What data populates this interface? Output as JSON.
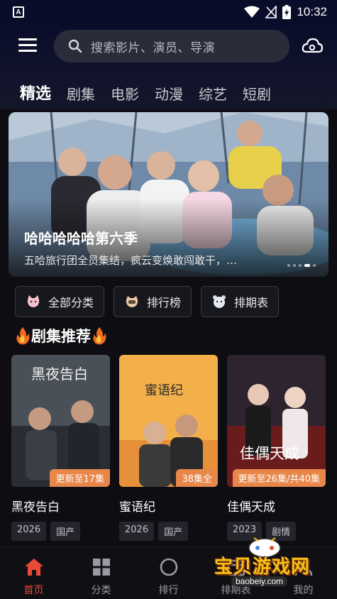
{
  "status_bar": {
    "app_glyph": "A",
    "time": "10:32"
  },
  "search": {
    "placeholder": "搜索影片、演员、导演"
  },
  "tabs": [
    {
      "label": "精选",
      "active": true
    },
    {
      "label": "剧集"
    },
    {
      "label": "电影"
    },
    {
      "label": "动漫"
    },
    {
      "label": "综艺"
    },
    {
      "label": "短剧"
    }
  ],
  "banner": {
    "title": "哈哈哈哈哈第六季",
    "description": "五哈旅行团全员集结，疯云变焕敢闯敢干，…",
    "dots": 5,
    "active_dot": 3
  },
  "quick_links": [
    {
      "label": "全部分类",
      "icon": "cat-icon"
    },
    {
      "label": "排行榜",
      "icon": "cat-face-icon"
    },
    {
      "label": "排期表",
      "icon": "bear-icon"
    }
  ],
  "section": {
    "title": "剧集推荐",
    "icon": "fire-icon"
  },
  "cards": [
    {
      "title": "黑夜告白",
      "badge": "更新至17集",
      "year": "2026",
      "tag": "国产",
      "poster_text": "黑夜告白",
      "colors": [
        "#5a6270",
        "#2a2e36"
      ]
    },
    {
      "title": "蜜语纪",
      "badge": "38集全",
      "year": "2026",
      "tag": "国产",
      "poster_text": "蜜语纪",
      "colors": [
        "#f4b24a",
        "#e07a2a"
      ]
    },
    {
      "title": "佳偶天成",
      "badge": "更新至26集/共40集",
      "year": "2023",
      "tag": "剧情",
      "poster_text": "佳偶天成",
      "colors": [
        "#3a2a3a",
        "#7a1a1a"
      ]
    }
  ],
  "nav": [
    {
      "label": "首页",
      "icon": "home-icon",
      "active": true
    },
    {
      "label": "分类",
      "icon": "grid-icon"
    },
    {
      "label": "排行",
      "icon": "circle-icon"
    },
    {
      "label": "排期表",
      "icon": "calendar-icon"
    },
    {
      "label": "我的",
      "icon": "user-icon"
    }
  ],
  "watermark": {
    "text": "宝贝游戏网",
    "url": "baobeiy.com"
  },
  "colors": {
    "accent": "#e84a3a",
    "badge": "#e8874a",
    "background": "#0d0d12"
  }
}
